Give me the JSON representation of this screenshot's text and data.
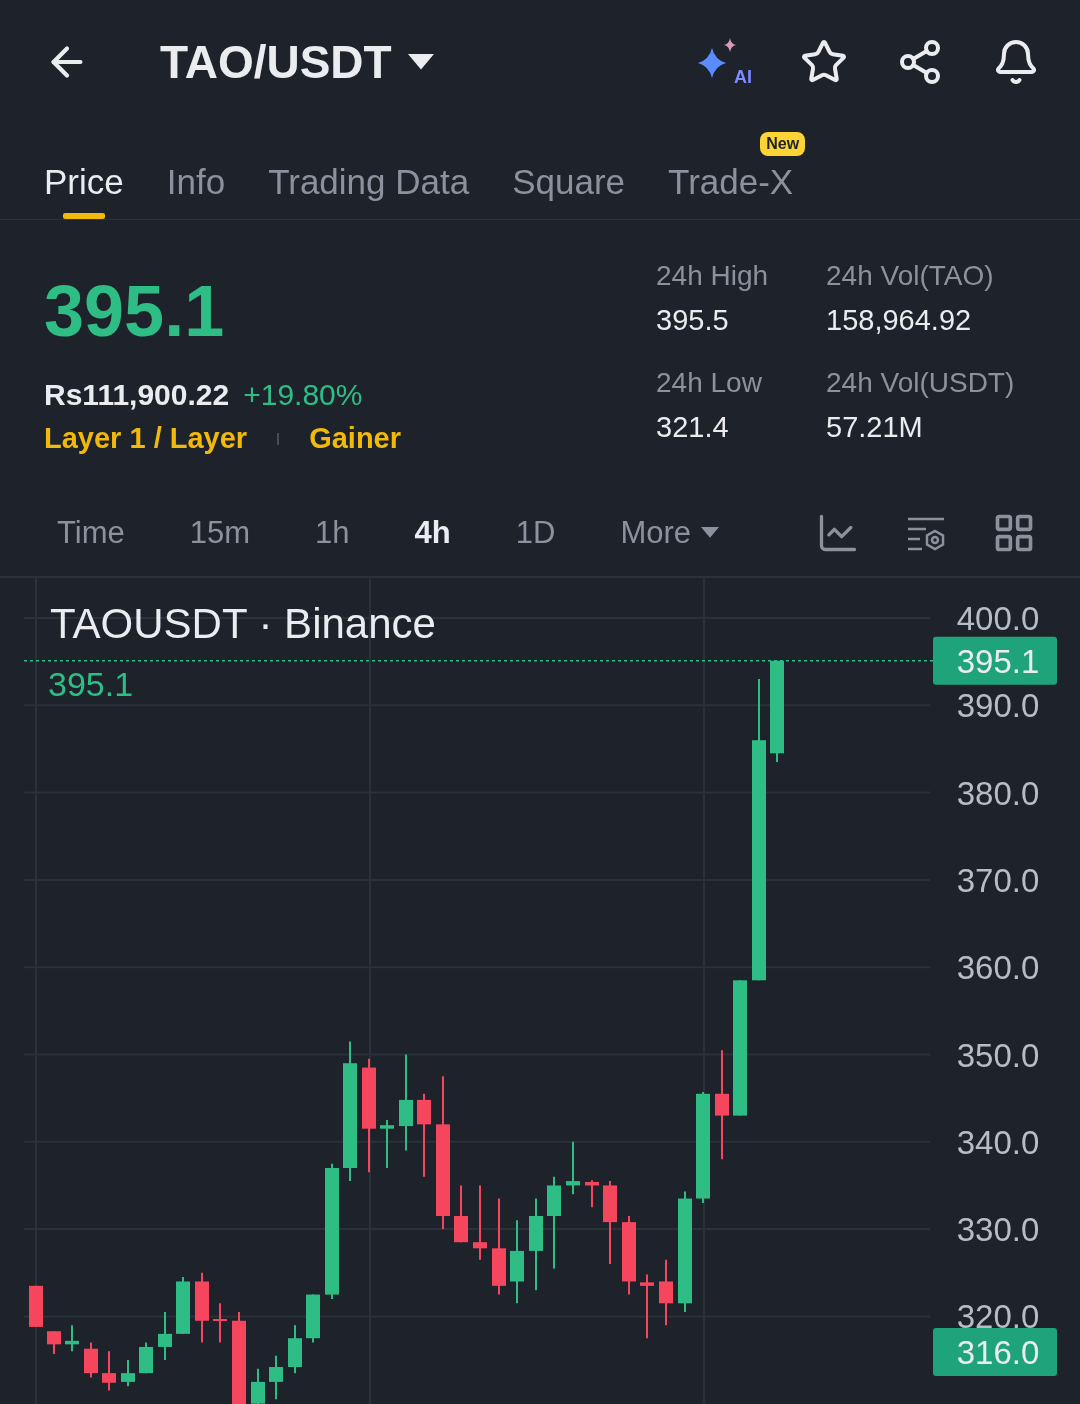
{
  "header": {
    "pair": "TAO/USDT",
    "ai_label": "AI"
  },
  "tabs": [
    {
      "label": "Price",
      "selected": true
    },
    {
      "label": "Info",
      "selected": false
    },
    {
      "label": "Trading Data",
      "selected": false
    },
    {
      "label": "Square",
      "selected": false
    },
    {
      "label": "Trade-X",
      "selected": false,
      "badge": "New"
    }
  ],
  "ticker": {
    "last_price": "395.1",
    "fiat_price": "Rs111,900.22",
    "change": "+19.80%",
    "tags": [
      "Layer 1 / Layer",
      "Gainer"
    ],
    "stats": [
      {
        "label": "24h High",
        "value": "395.5"
      },
      {
        "label": "24h Vol(TAO)",
        "value": "158,964.92"
      },
      {
        "label": "24h Low",
        "value": "321.4"
      },
      {
        "label": "24h Vol(USDT)",
        "value": "57.21M"
      }
    ]
  },
  "intervals": [
    {
      "label": "Time",
      "selected": false,
      "kind": "plain"
    },
    {
      "label": "15m",
      "selected": false,
      "kind": "plain"
    },
    {
      "label": "1h",
      "selected": false,
      "kind": "plain"
    },
    {
      "label": "4h",
      "selected": true,
      "kind": "plain"
    },
    {
      "label": "1D",
      "selected": false,
      "kind": "plain"
    },
    {
      "label": "More",
      "selected": false,
      "kind": "dropdown"
    }
  ],
  "chart": {
    "title": "TAOUSDT · Binance",
    "last_price_label": "395.1",
    "current_price_badge": "395.1",
    "low_badge": "316.0",
    "price_scale": [
      "400.0",
      "390.0",
      "380.0",
      "370.0",
      "360.0",
      "350.0",
      "340.0",
      "330.0",
      "320.0"
    ]
  }
}
